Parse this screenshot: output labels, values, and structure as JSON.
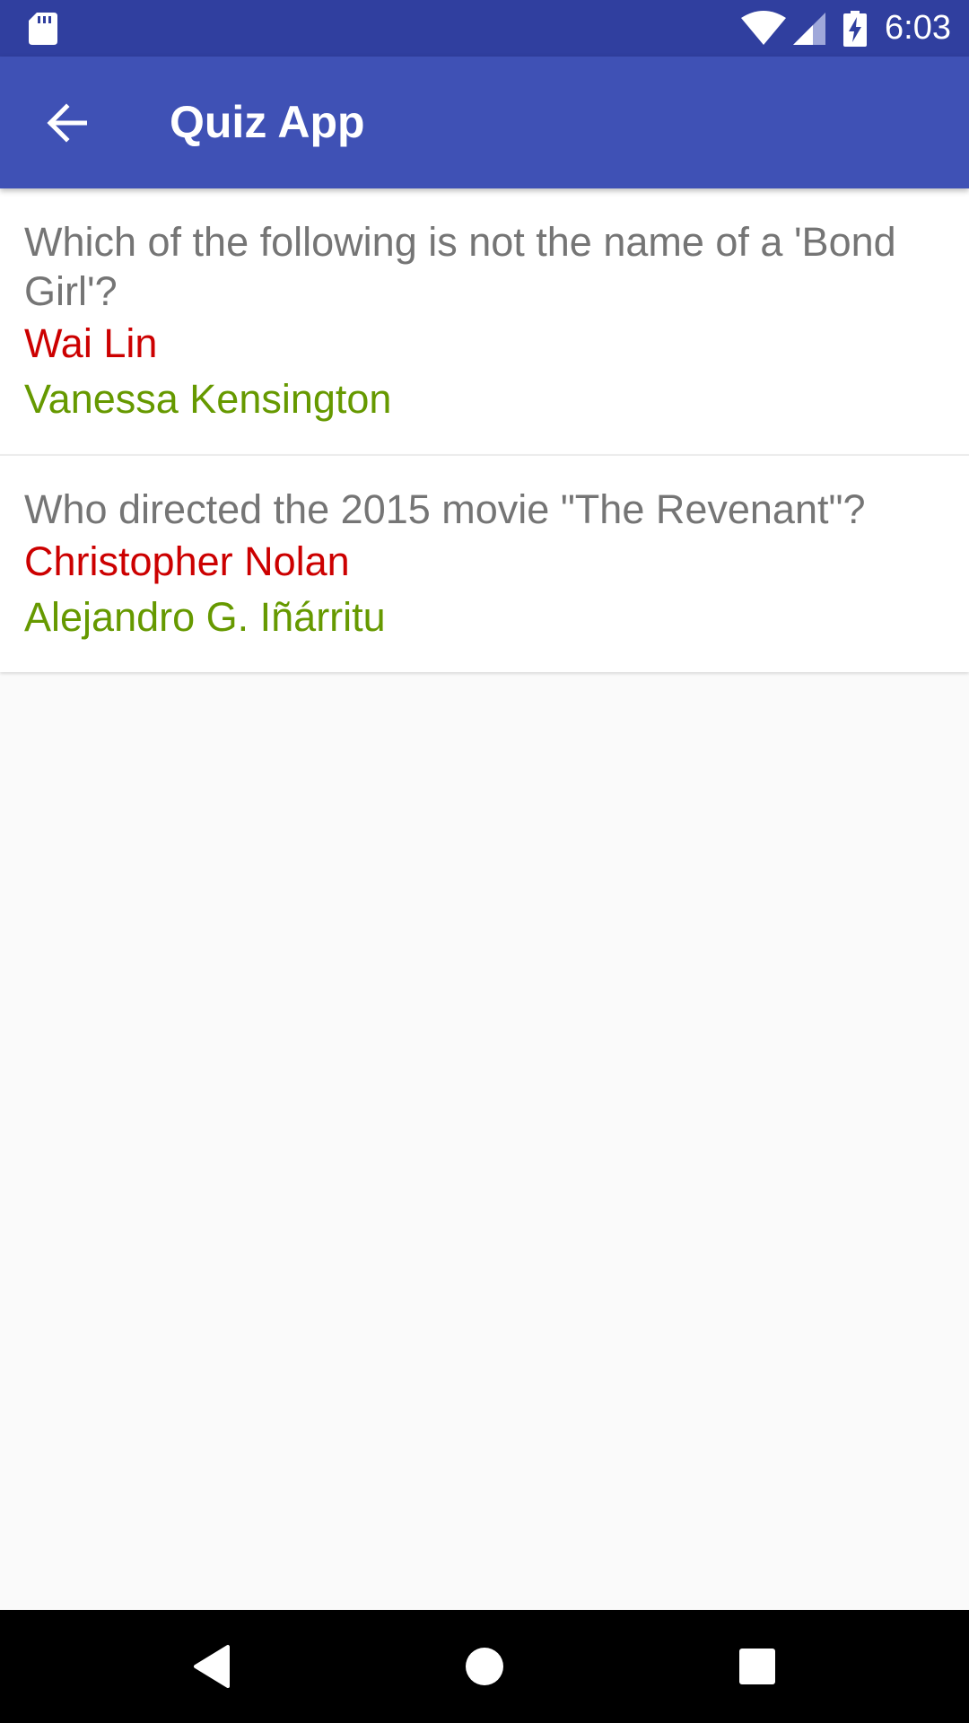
{
  "status_bar": {
    "time": "6:03",
    "icons": [
      "sd-card-icon",
      "wifi-icon",
      "cell-signal-icon",
      "battery-charging-icon"
    ]
  },
  "app_bar": {
    "title": "Quiz App",
    "back_icon": "arrow-back-icon"
  },
  "questions": [
    {
      "text": "Which of the following is not the name of a 'Bond Girl'?",
      "wrong_answer": "Wai Lin",
      "correct_answer": "Vanessa Kensington"
    },
    {
      "text": "Who directed the 2015 movie \"The Revenant\"?",
      "wrong_answer": "Christopher Nolan",
      "correct_answer": "Alejandro G. Iñárritu"
    }
  ],
  "nav_bar": {
    "icons": [
      "back-triangle-icon",
      "home-circle-icon",
      "recents-square-icon"
    ]
  },
  "colors": {
    "status_bar": "#303f9f",
    "app_bar": "#3f51b5",
    "wrong": "#cc0000",
    "correct": "#669900",
    "question": "#757575",
    "background": "#fafafa"
  }
}
